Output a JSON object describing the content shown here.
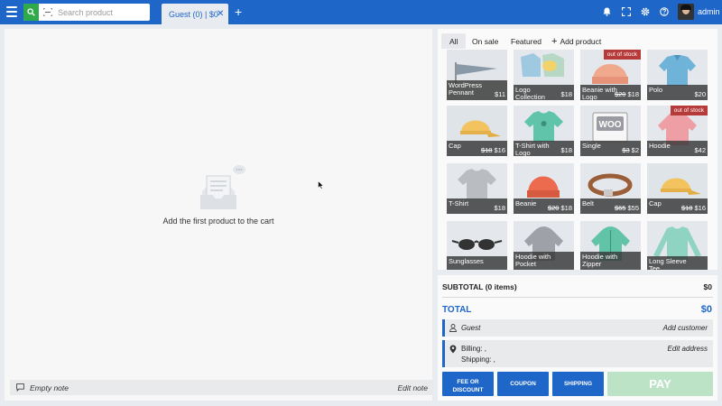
{
  "topbar": {
    "search_placeholder": "Search product",
    "tab_label": "Guest (0) | $0",
    "tab_close": "✕",
    "tab_add": "+",
    "user_name": "admin",
    "accent": "#1f66c9",
    "search_button_color": "#2eaa4a"
  },
  "cart": {
    "empty_message": "Add the first product to the cart",
    "note_text": "Empty note",
    "edit_note": "Edit note"
  },
  "products": {
    "tabs": [
      "All",
      "On sale",
      "Featured",
      "Add product"
    ],
    "items": [
      {
        "name": "WordPress Pennant",
        "price": "$11",
        "old_price": "",
        "badge": ""
      },
      {
        "name": "Logo Collection",
        "price": "$18",
        "old_price": "",
        "badge": ""
      },
      {
        "name": "Beanie with Logo",
        "price": "$18",
        "old_price": "$20",
        "badge": "out of stock"
      },
      {
        "name": "Polo",
        "price": "$20",
        "old_price": "",
        "badge": ""
      },
      {
        "name": "Cap",
        "price": "$16",
        "old_price": "$18",
        "badge": ""
      },
      {
        "name": "T-Shirt with Logo",
        "price": "$18",
        "old_price": "",
        "badge": ""
      },
      {
        "name": "Single",
        "price": "$2",
        "old_price": "$3",
        "badge": ""
      },
      {
        "name": "Hoodie",
        "price": "$42",
        "old_price": "",
        "badge": "out of stock"
      },
      {
        "name": "T-Shirt",
        "price": "$18",
        "old_price": "",
        "badge": ""
      },
      {
        "name": "Beanie",
        "price": "$18",
        "old_price": "$20",
        "badge": ""
      },
      {
        "name": "Belt",
        "price": "$55",
        "old_price": "$65",
        "badge": ""
      },
      {
        "name": "Cap",
        "price": "$16",
        "old_price": "$18",
        "badge": ""
      },
      {
        "name": "Sunglasses",
        "price": "",
        "old_price": "",
        "badge": ""
      },
      {
        "name": "Hoodie with Pocket",
        "price": "",
        "old_price": "",
        "badge": ""
      },
      {
        "name": "Hoodie with Zipper",
        "price": "",
        "old_price": "",
        "badge": ""
      },
      {
        "name": "Long Sleeve Tee",
        "price": "",
        "old_price": "",
        "badge": ""
      }
    ]
  },
  "totals": {
    "subtotal_label": "SUBTOTAL (0 items)",
    "subtotal_value": "$0",
    "total_label": "TOTAL",
    "total_value": "$0",
    "customer": "Guest",
    "add_customer": "Add customer",
    "billing": "Billing: ,",
    "shipping": "Shipping: ,",
    "edit_address": "Edit address",
    "fee_button": "FEE OR DISCOUNT",
    "coupon_button": "COUPON",
    "shipping_button": "SHIPPING",
    "pay_button": "PAY"
  }
}
